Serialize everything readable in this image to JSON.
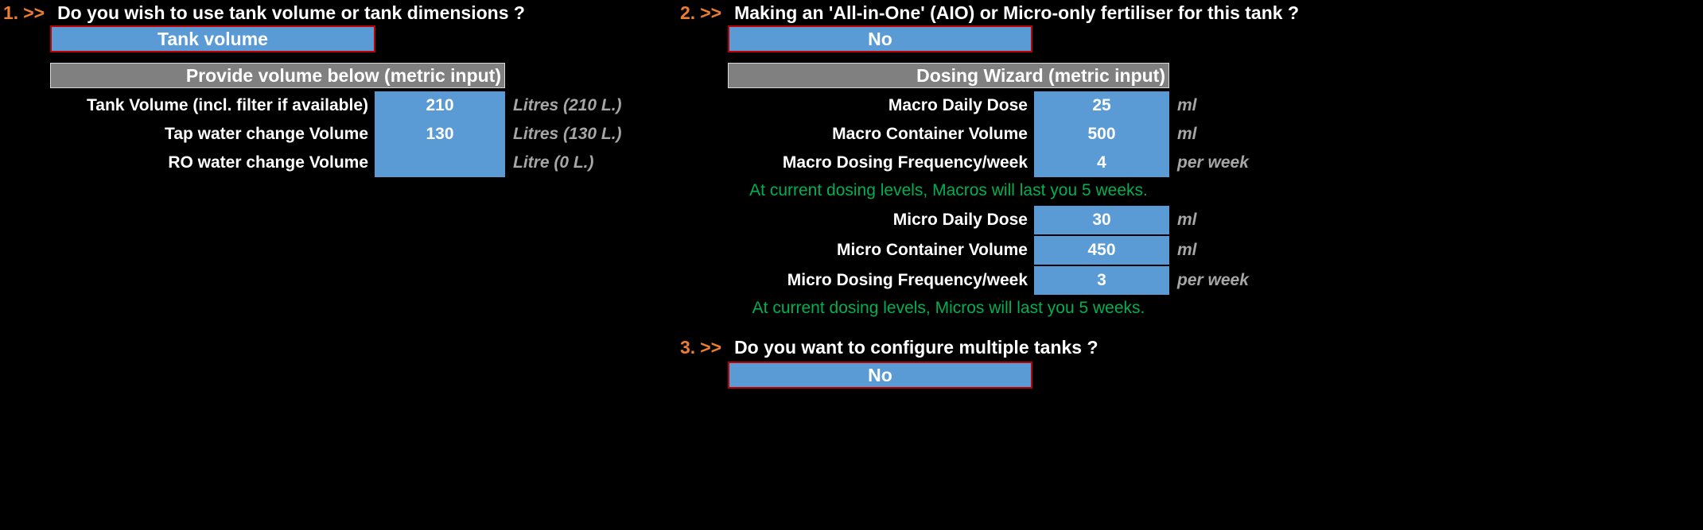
{
  "theme": {
    "background": "#000000",
    "accent_orange": "#ED7D31",
    "input_blue": "#5B9BD5",
    "section_grey": "#808080",
    "note_green": "#00B050",
    "unit_grey": "#A6A6A6",
    "dropdown_border_red": "#C00000"
  },
  "questions": {
    "q1": {
      "number": "1.",
      "arrow": ">>",
      "text": "Do you wish to use tank volume or tank dimensions ?",
      "dropdown_value": "Tank volume"
    },
    "q2": {
      "number": "2.",
      "arrow": ">>",
      "text": "Making an 'All-in-One' (AIO) or Micro-only fertiliser for this tank ?",
      "dropdown_value": "No"
    },
    "q3": {
      "number": "3.",
      "arrow": ">>",
      "text": "Do you want to configure multiple tanks ?",
      "dropdown_value": "No"
    }
  },
  "volume_section": {
    "header": "Provide volume below (metric input)",
    "rows": [
      {
        "label": "Tank Volume (incl. filter if available)",
        "value": "210",
        "unit": "Litres (210 L.)"
      },
      {
        "label": "Tap water change Volume",
        "value": "130",
        "unit": "Litres (130 L.)"
      },
      {
        "label": "RO water change Volume",
        "value": "",
        "unit": "Litre (0 L.)"
      }
    ]
  },
  "dosing_section": {
    "header": "Dosing Wizard (metric input)",
    "macro_rows": [
      {
        "label": "Macro Daily Dose",
        "value": "25",
        "unit": "ml"
      },
      {
        "label": "Macro Container Volume",
        "value": "500",
        "unit": "ml"
      },
      {
        "label": "Macro Dosing Frequency/week",
        "value": "4",
        "unit": "per week"
      }
    ],
    "macro_note": "At current dosing levels, Macros will last you 5 weeks.",
    "micro_rows": [
      {
        "label": "Micro Daily Dose",
        "value": "30",
        "unit": "ml"
      },
      {
        "label": "Micro Container Volume",
        "value": "450",
        "unit": "ml"
      },
      {
        "label": "Micro Dosing Frequency/week",
        "value": "3",
        "unit": "per week"
      }
    ],
    "micro_note": "At current dosing levels, Micros will last you 5 weeks."
  }
}
